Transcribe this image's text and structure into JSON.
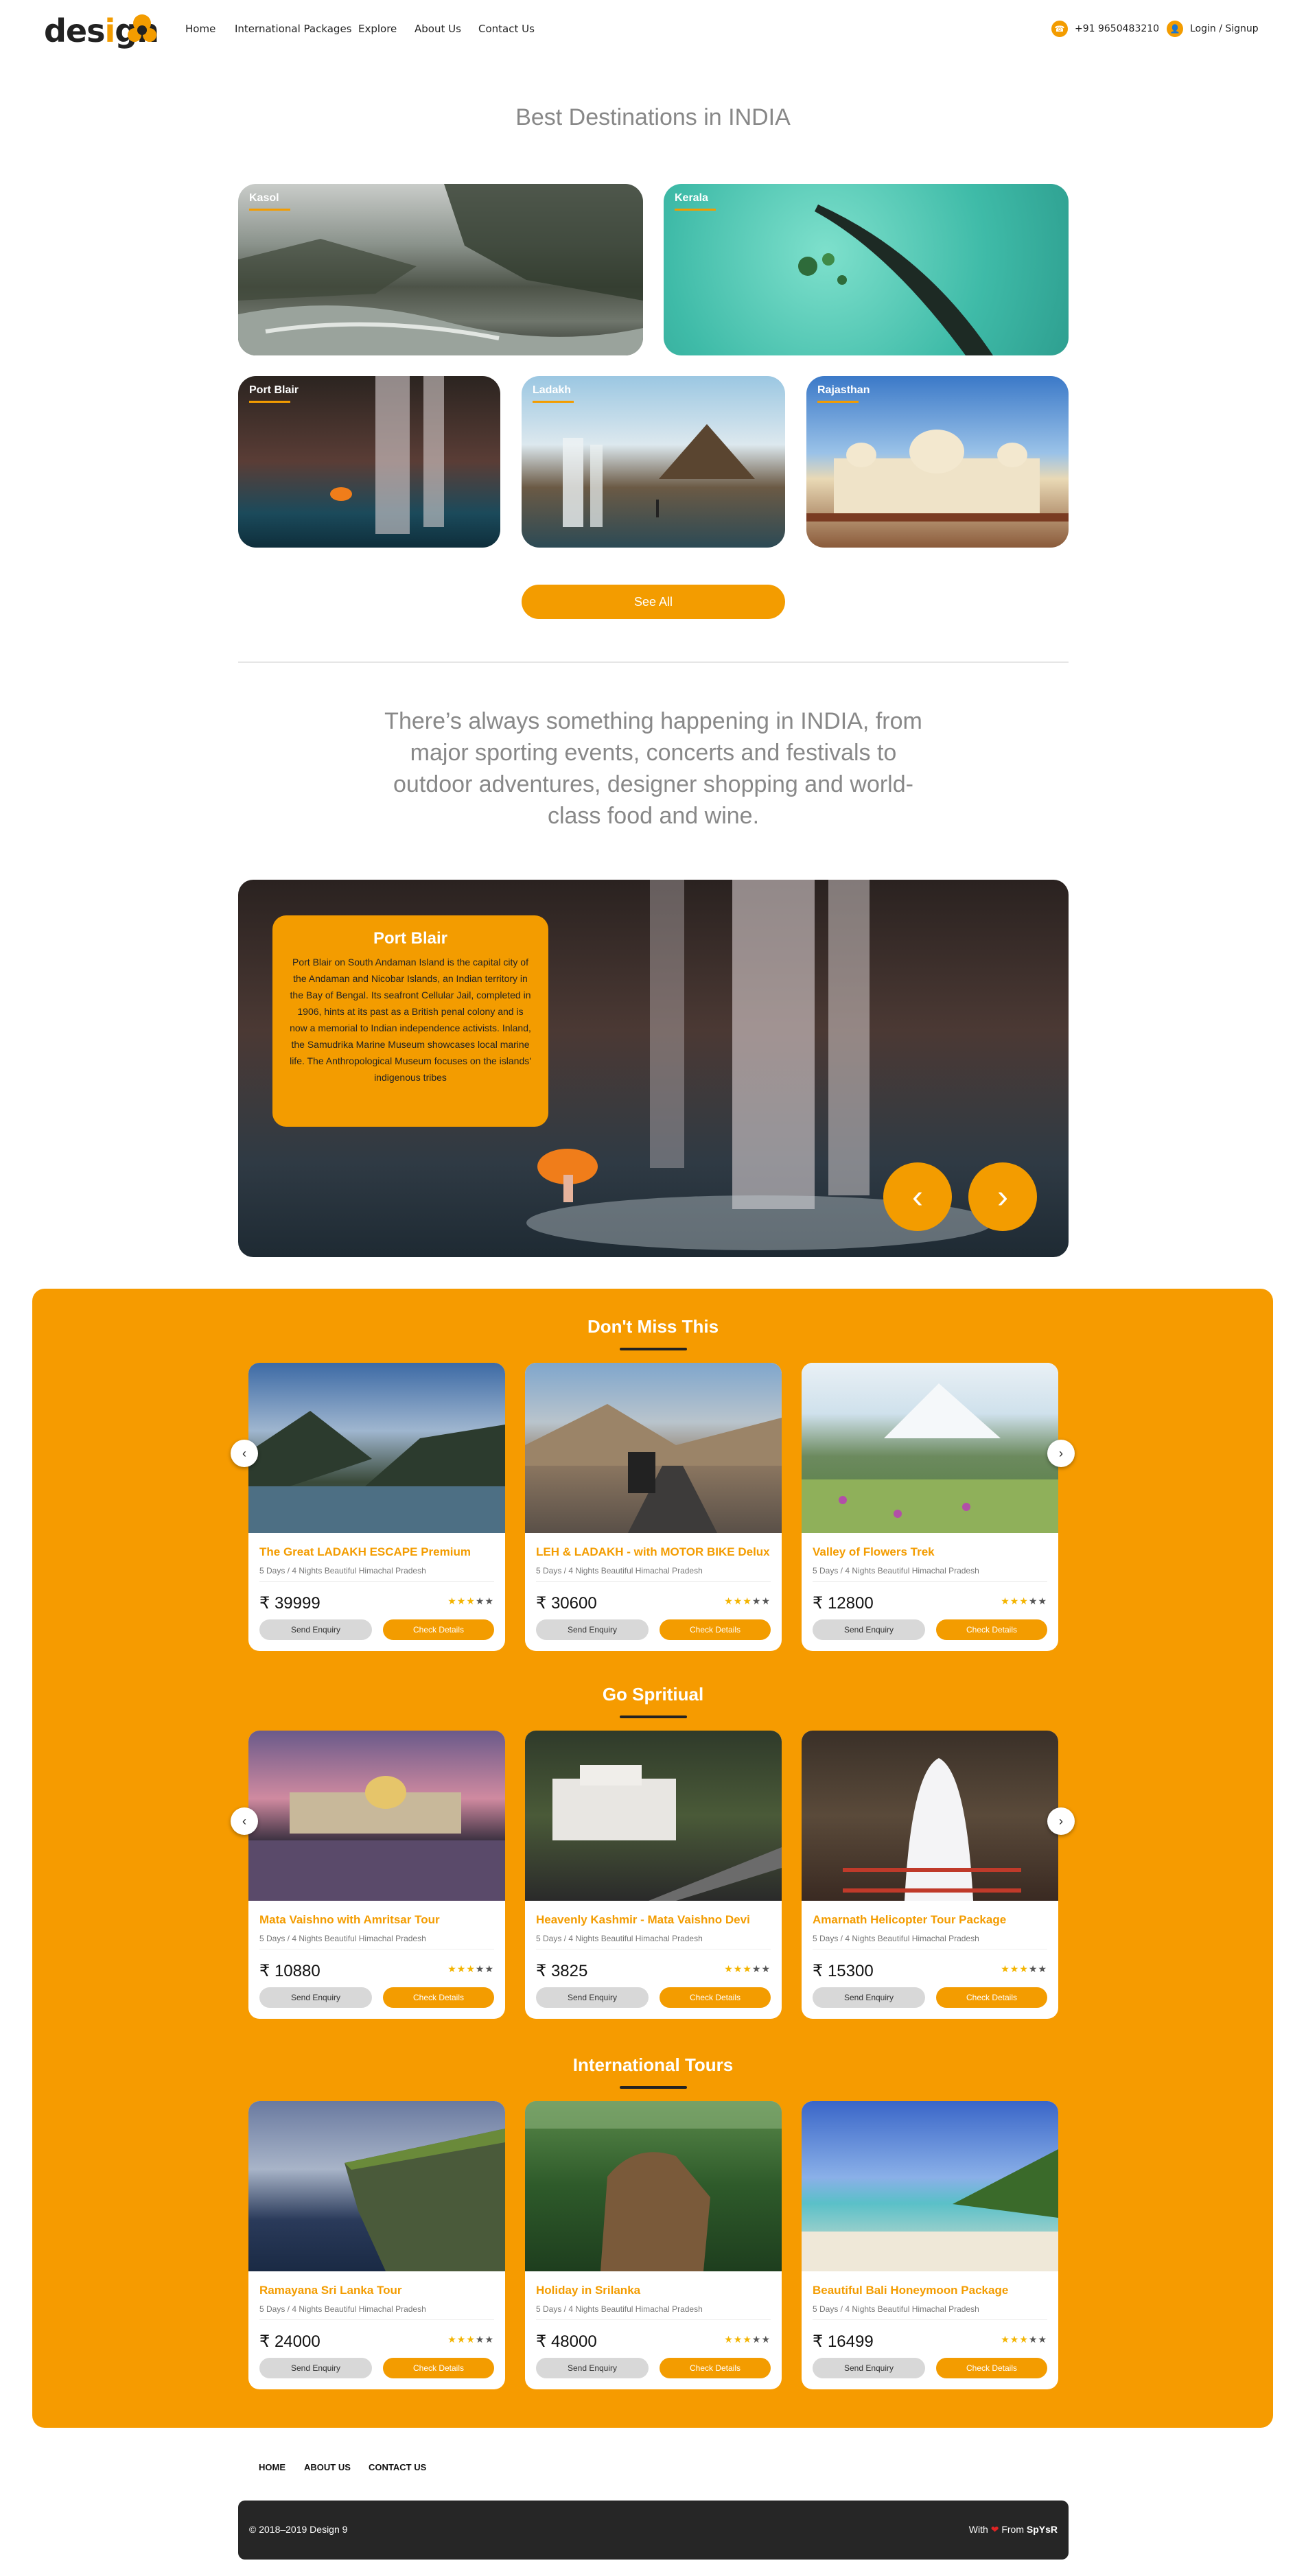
{
  "header": {
    "logo_pre": "des",
    "logo_i": "i",
    "logo_post": "gn",
    "nav": [
      "Home",
      "International Packages",
      "Explore",
      "About Us",
      "Contact Us"
    ],
    "phone": "+91 9650483210",
    "login": "Login / Signup",
    "icons": {
      "phone": "phone-icon",
      "user": "user-icon"
    }
  },
  "destinations": {
    "title": "Best Destinations in INDIA",
    "items": [
      "Kasol",
      "Kerala",
      "Port Blair",
      "Ladakh",
      "Rajasthan"
    ],
    "see_all": "See All"
  },
  "quote": "There’s always something happening in INDIA, from major sporting events, concerts and festivals to outdoor adventures, designer shopping and world-class food and wine.",
  "slider": {
    "title": "Port Blair",
    "text": "Port Blair on South Andaman Island is the capital city of the Andaman and Nicobar Islands, an Indian territory in the Bay of Bengal. Its seafront Cellular Jail, completed in 1906, hints at its past as a British penal colony and is now a memorial to Indian independence activists. Inland, the Samudrika Marine Museum showcases local marine life. The Anthropological Museum focuses on the islands' indigenous tribes",
    "prev": "‹",
    "next": "›"
  },
  "groups": [
    {
      "title": "Don't Miss This",
      "cards": [
        {
          "title": "The Great LADAKH ESCAPE Premium",
          "sub": "5 Days / 4 Nights Beautiful Himachal Pradesh",
          "price": "₹ 39999",
          "rating": 3
        },
        {
          "title": "LEH & LADAKH - with MOTOR BIKE Delux",
          "sub": "5 Days / 4 Nights Beautiful Himachal Pradesh",
          "price": "₹ 30600",
          "rating": 3
        },
        {
          "title": "Valley of Flowers Trek",
          "sub": "5 Days / 4 Nights Beautiful Himachal Pradesh",
          "price": "₹ 12800",
          "rating": 3
        }
      ]
    },
    {
      "title": "Go Spritiual",
      "cards": [
        {
          "title": "Mata Vaishno with Amritsar Tour",
          "sub": "5 Days / 4 Nights Beautiful Himachal Pradesh",
          "price": "₹ 10880",
          "rating": 3
        },
        {
          "title": "Heavenly Kashmir - Mata Vaishno Devi",
          "sub": "5 Days / 4 Nights Beautiful Himachal Pradesh",
          "price": "₹ 3825",
          "rating": 3
        },
        {
          "title": "Amarnath Helicopter Tour Package",
          "sub": "5 Days / 4 Nights Beautiful Himachal Pradesh",
          "price": "₹ 15300",
          "rating": 3
        }
      ]
    },
    {
      "title": "International Tours",
      "cards": [
        {
          "title": "Ramayana Sri Lanka Tour",
          "sub": "5 Days / 4 Nights Beautiful Himachal Pradesh",
          "price": "₹ 24000",
          "rating": 3
        },
        {
          "title": "Holiday in Srilanka",
          "sub": "5 Days / 4 Nights Beautiful Himachal Pradesh",
          "price": "₹ 48000",
          "rating": 3
        },
        {
          "title": "Beautiful Bali Honeymoon Package",
          "sub": "5 Days / 4 Nights Beautiful Himachal Pradesh",
          "price": "₹ 16499",
          "rating": 3
        }
      ]
    }
  ],
  "card_buttons": {
    "enquiry": "Send Enquiry",
    "details": "Check Details"
  },
  "footer": {
    "links": [
      "HOME",
      "ABOUT US",
      "CONTACT US"
    ],
    "copyright": "© 2018–2019 Design 9",
    "made_with": "With",
    "heart": "❤",
    "from": "From",
    "brand": "SpYsR"
  },
  "colors": {
    "accent": "#f39c00",
    "panel": "#f69b00",
    "dark": "#262626"
  }
}
